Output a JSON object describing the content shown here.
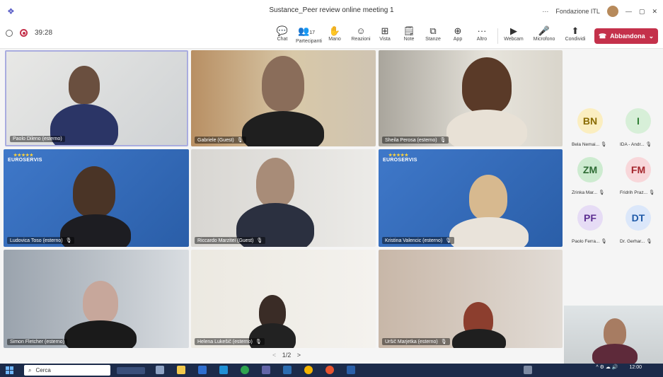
{
  "window": {
    "title": "Sustance_Peer review online meeting 1",
    "more": "···",
    "org": "Fondazione ITL",
    "min": "—",
    "max": "▢",
    "close": "✕"
  },
  "toolbar": {
    "timer": "39:28",
    "participants_count": "17",
    "buttons": [
      {
        "label": "Chat",
        "icon": "chat-icon",
        "glyph": "💬"
      },
      {
        "label": "Partecipanti",
        "icon": "people-icon",
        "glyph": "👥"
      },
      {
        "label": "Mano",
        "icon": "hand-icon",
        "glyph": "✋"
      },
      {
        "label": "Reazioni",
        "icon": "smile-icon",
        "glyph": "☺"
      },
      {
        "label": "Vista",
        "icon": "grid-icon",
        "glyph": "⊞"
      },
      {
        "label": "Note",
        "icon": "notes-icon",
        "glyph": "🗒"
      },
      {
        "label": "Stanze",
        "icon": "rooms-icon",
        "glyph": "⧉"
      },
      {
        "label": "App",
        "icon": "add-icon",
        "glyph": "⊕"
      },
      {
        "label": "Altro",
        "icon": "more-icon",
        "glyph": "···"
      },
      {
        "label": "Webcam",
        "icon": "camera-icon",
        "glyph": "▶"
      },
      {
        "label": "Microfono",
        "icon": "mic-off-icon",
        "glyph": "🎤"
      },
      {
        "label": "Condividi",
        "icon": "share-icon",
        "glyph": "⬆"
      }
    ],
    "leave_label": "Abbandona"
  },
  "tiles": [
    {
      "name": "Paolo Dileno (esterno)",
      "mic": ""
    },
    {
      "name": "Gabriele (Guest)",
      "mic": "🎙"
    },
    {
      "name": "Sheila Perosa (esterno)",
      "mic": "🎙"
    },
    {
      "name": "Ludovica Toso (esterno)",
      "mic": "🎙"
    },
    {
      "name": "Riccardo Marzitei (Guest)",
      "mic": "🎙"
    },
    {
      "name": "Kristina Valencic (esterno)",
      "mic": "🎙"
    },
    {
      "name": "Simon Fletcher (esterno)",
      "mic": ""
    },
    {
      "name": "Helena Lukešič (esterno)",
      "mic": "🎙"
    },
    {
      "name": "Uršič Marjetka (esterno)",
      "mic": "🎙"
    }
  ],
  "euroservis": {
    "label": "EUROSERVIS",
    "stars": "★★★★★"
  },
  "pager": {
    "prev": "<",
    "text": "1/2",
    "next": ">"
  },
  "rail": [
    {
      "initials": "BN",
      "name": "Bela Nemai...",
      "mic": "🎙",
      "bg": "#fbeec0",
      "fg": "#8a6b00"
    },
    {
      "initials": "I",
      "name": "IDA - Andr...",
      "mic": "🎙",
      "bg": "#d7efd8",
      "fg": "#2e7d32"
    },
    {
      "initials": "ZM",
      "name": "Zrinka Mar...",
      "mic": "🎙",
      "bg": "#cdebd0",
      "fg": "#2e6b34"
    },
    {
      "initials": "FM",
      "name": "Fridrih Praz...",
      "mic": "🎙",
      "bg": "#f8d7da",
      "fg": "#a4262c"
    },
    {
      "initials": "PF",
      "name": "Paolo Ferra...",
      "mic": "🎙",
      "bg": "#e6dcf5",
      "fg": "#5c2e91"
    },
    {
      "initials": "DT",
      "name": "Dr. Gerhar...",
      "mic": "🎙",
      "bg": "#dbe7fa",
      "fg": "#1f5aa8"
    }
  ],
  "taskbar": {
    "search_placeholder": "Cerca",
    "time": "12:00",
    "date": "",
    "tray": "^ ⚙ ☁ 🔊"
  }
}
